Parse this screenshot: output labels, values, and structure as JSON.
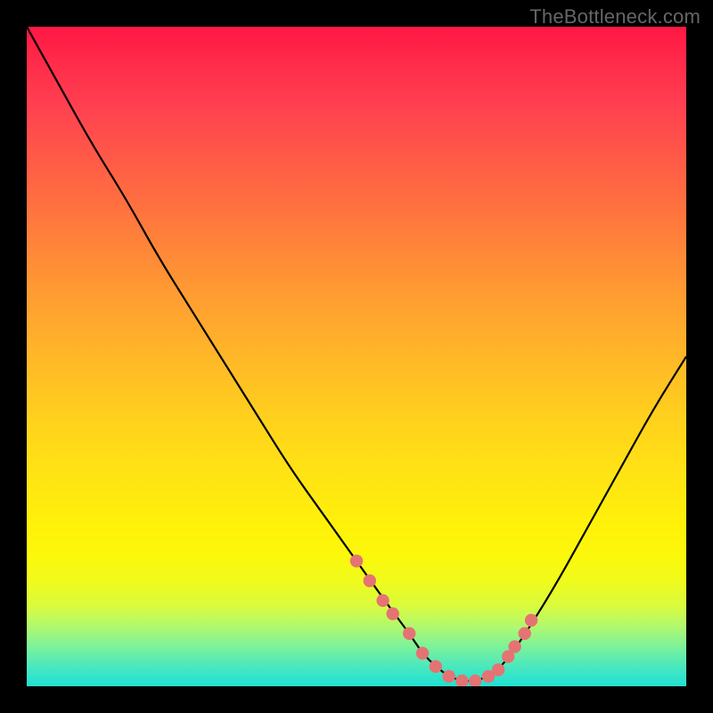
{
  "watermark": "TheBottleneck.com",
  "chart_data": {
    "type": "line",
    "title": "",
    "xlabel": "",
    "ylabel": "",
    "xlim": [
      0,
      100
    ],
    "ylim": [
      0,
      100
    ],
    "curve": {
      "name": "bottleneck-curve",
      "x": [
        0,
        5,
        10,
        15,
        20,
        25,
        30,
        35,
        40,
        45,
        50,
        55,
        58,
        60,
        62,
        64,
        66,
        68,
        70,
        72,
        75,
        80,
        85,
        90,
        95,
        100
      ],
      "y": [
        100,
        91,
        82,
        74,
        65,
        57,
        49,
        41,
        33,
        26,
        19,
        12,
        8,
        5,
        3,
        1.5,
        0.8,
        0.8,
        1.5,
        3,
        7,
        15,
        24,
        33,
        42,
        50
      ]
    },
    "markers": {
      "name": "highlight-dots",
      "color": "#e57373",
      "x": [
        50,
        52,
        54,
        55.5,
        58,
        60,
        62,
        64,
        66,
        68,
        70,
        71.5,
        73,
        74,
        75.5,
        76.5
      ],
      "y": [
        19,
        16,
        13,
        11,
        8,
        5,
        3,
        1.5,
        0.8,
        0.8,
        1.5,
        2.5,
        4.5,
        6,
        8,
        10
      ]
    },
    "gradient_stops": [
      {
        "pos": 0,
        "color": "#ff1744"
      },
      {
        "pos": 50,
        "color": "#ffd21c"
      },
      {
        "pos": 100,
        "color": "#1fe0d2"
      }
    ]
  }
}
